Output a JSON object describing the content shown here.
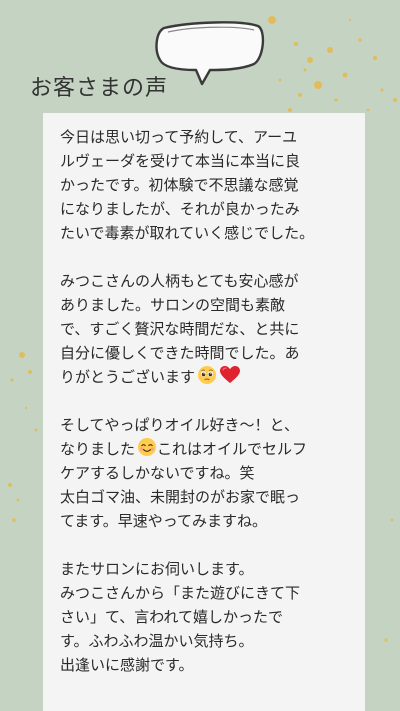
{
  "title": "お客さまの声",
  "testimonial": {
    "paragraphs": [
      {
        "lines": [
          "今日は思い切って予約して、アーユ",
          "ルヴェーダを受けて本当に本当に良",
          "かったです。初体験で不思議な感覚",
          "になりましたが、それが良かったみ",
          "たいで毒素が取れていく感じでした。"
        ]
      },
      {
        "lines": [
          "みつこさんの人柄もとても安心感が",
          "ありました。サロンの空間も素敵",
          "で、すごく贅沢な時間だな、と共に",
          "自分に優しくできた時間でした。あ",
          "りがとうございます"
        ]
      },
      {
        "lines": [
          "そしてやっぱりオイル好き〜！と、",
          "なりました",
          "ケアするしかないですね。笑",
          "太白ゴマ油、未開封のがお家で眠っ",
          "てます。早速やってみますね。"
        ],
        "line2_suffix": "これはオイルでセルフ"
      },
      {
        "lines": [
          "またサロンにお伺いします。",
          "みつこさんから「また遊びにきて下",
          "さい」て、言われて嬉しかったで",
          "す。ふわふわ温かい気持ち。",
          "出逢いに感謝です。"
        ]
      }
    ]
  },
  "icons": {
    "pleading": "pleading-face-icon",
    "heart": "red-heart-icon",
    "smile": "smiling-face-icon"
  },
  "colors": {
    "background": "#c5d3c2",
    "card": "#f4f4f4",
    "gold": "#e8b84a",
    "heart": "#e0242f"
  }
}
